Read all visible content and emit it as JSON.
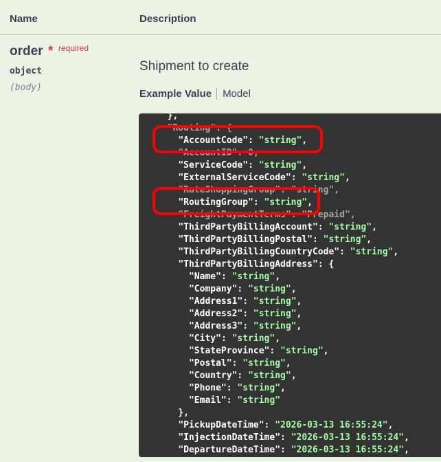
{
  "table": {
    "header_name": "Name",
    "header_description": "Description"
  },
  "parameter": {
    "name": "order",
    "required_star": "*",
    "required_label": "required",
    "type": "object",
    "in": "(body)",
    "description": "Shipment to create"
  },
  "tabs": {
    "example_value": "Example Value",
    "model": "Model"
  },
  "code_lines": [
    {
      "indent": "  ",
      "parts": [
        {
          "c": "p",
          "t": "},"
        }
      ]
    },
    {
      "indent": "  ",
      "parts": [
        {
          "c": "o",
          "t": "\"Routing\": {"
        }
      ]
    },
    {
      "indent": "    ",
      "parts": [
        {
          "c": "k",
          "t": "\"AccountCode\""
        },
        {
          "c": "p",
          "t": ": "
        },
        {
          "c": "s",
          "t": "\"string\""
        },
        {
          "c": "p",
          "t": ","
        }
      ]
    },
    {
      "indent": "    ",
      "parts": [
        {
          "c": "o",
          "t": "\"AccountID\": 0,"
        }
      ]
    },
    {
      "indent": "    ",
      "parts": [
        {
          "c": "k",
          "t": "\"ServiceCode\""
        },
        {
          "c": "p",
          "t": ": "
        },
        {
          "c": "s",
          "t": "\"string\""
        },
        {
          "c": "p",
          "t": ","
        }
      ]
    },
    {
      "indent": "    ",
      "parts": [
        {
          "c": "k",
          "t": "\"ExternalServiceCode\""
        },
        {
          "c": "p",
          "t": ": "
        },
        {
          "c": "s",
          "t": "\"string\""
        },
        {
          "c": "p",
          "t": ","
        }
      ]
    },
    {
      "indent": "    ",
      "parts": [
        {
          "c": "o",
          "t": "\"RateShoppingGroup\": \"string\","
        }
      ]
    },
    {
      "indent": "    ",
      "parts": [
        {
          "c": "k",
          "t": "\"RoutingGroup\""
        },
        {
          "c": "p",
          "t": ": "
        },
        {
          "c": "s",
          "t": "\"string\""
        },
        {
          "c": "p",
          "t": ","
        }
      ]
    },
    {
      "indent": "    ",
      "parts": [
        {
          "c": "o",
          "t": "\"FreightPaymentTerms\": \"Prepaid\","
        }
      ]
    },
    {
      "indent": "    ",
      "parts": [
        {
          "c": "k",
          "t": "\"ThirdPartyBillingAccount\""
        },
        {
          "c": "p",
          "t": ": "
        },
        {
          "c": "s",
          "t": "\"string\""
        },
        {
          "c": "p",
          "t": ","
        }
      ]
    },
    {
      "indent": "    ",
      "parts": [
        {
          "c": "k",
          "t": "\"ThirdPartyBillingPostal\""
        },
        {
          "c": "p",
          "t": ": "
        },
        {
          "c": "s",
          "t": "\"string\""
        },
        {
          "c": "p",
          "t": ","
        }
      ]
    },
    {
      "indent": "    ",
      "parts": [
        {
          "c": "k",
          "t": "\"ThirdPartyBillingCountryCode\""
        },
        {
          "c": "p",
          "t": ": "
        },
        {
          "c": "s",
          "t": "\"string\""
        },
        {
          "c": "p",
          "t": ","
        }
      ]
    },
    {
      "indent": "    ",
      "parts": [
        {
          "c": "k",
          "t": "\"ThirdPartyBillingAddress\""
        },
        {
          "c": "p",
          "t": ": {"
        }
      ]
    },
    {
      "indent": "      ",
      "parts": [
        {
          "c": "k",
          "t": "\"Name\""
        },
        {
          "c": "p",
          "t": ": "
        },
        {
          "c": "s",
          "t": "\"string\""
        },
        {
          "c": "p",
          "t": ","
        }
      ]
    },
    {
      "indent": "      ",
      "parts": [
        {
          "c": "k",
          "t": "\"Company\""
        },
        {
          "c": "p",
          "t": ": "
        },
        {
          "c": "s",
          "t": "\"string\""
        },
        {
          "c": "p",
          "t": ","
        }
      ]
    },
    {
      "indent": "      ",
      "parts": [
        {
          "c": "k",
          "t": "\"Address1\""
        },
        {
          "c": "p",
          "t": ": "
        },
        {
          "c": "s",
          "t": "\"string\""
        },
        {
          "c": "p",
          "t": ","
        }
      ]
    },
    {
      "indent": "      ",
      "parts": [
        {
          "c": "k",
          "t": "\"Address2\""
        },
        {
          "c": "p",
          "t": ": "
        },
        {
          "c": "s",
          "t": "\"string\""
        },
        {
          "c": "p",
          "t": ","
        }
      ]
    },
    {
      "indent": "      ",
      "parts": [
        {
          "c": "k",
          "t": "\"Address3\""
        },
        {
          "c": "p",
          "t": ": "
        },
        {
          "c": "s",
          "t": "\"string\""
        },
        {
          "c": "p",
          "t": ","
        }
      ]
    },
    {
      "indent": "      ",
      "parts": [
        {
          "c": "k",
          "t": "\"City\""
        },
        {
          "c": "p",
          "t": ": "
        },
        {
          "c": "s",
          "t": "\"string\""
        },
        {
          "c": "p",
          "t": ","
        }
      ]
    },
    {
      "indent": "      ",
      "parts": [
        {
          "c": "k",
          "t": "\"StateProvince\""
        },
        {
          "c": "p",
          "t": ": "
        },
        {
          "c": "s",
          "t": "\"string\""
        },
        {
          "c": "p",
          "t": ","
        }
      ]
    },
    {
      "indent": "      ",
      "parts": [
        {
          "c": "k",
          "t": "\"Postal\""
        },
        {
          "c": "p",
          "t": ": "
        },
        {
          "c": "s",
          "t": "\"string\""
        },
        {
          "c": "p",
          "t": ","
        }
      ]
    },
    {
      "indent": "      ",
      "parts": [
        {
          "c": "k",
          "t": "\"Country\""
        },
        {
          "c": "p",
          "t": ": "
        },
        {
          "c": "s",
          "t": "\"string\""
        },
        {
          "c": "p",
          "t": ","
        }
      ]
    },
    {
      "indent": "      ",
      "parts": [
        {
          "c": "k",
          "t": "\"Phone\""
        },
        {
          "c": "p",
          "t": ": "
        },
        {
          "c": "s",
          "t": "\"string\""
        },
        {
          "c": "p",
          "t": ","
        }
      ]
    },
    {
      "indent": "      ",
      "parts": [
        {
          "c": "k",
          "t": "\"Email\""
        },
        {
          "c": "p",
          "t": ": "
        },
        {
          "c": "s",
          "t": "\"string\""
        }
      ]
    },
    {
      "indent": "    ",
      "parts": [
        {
          "c": "p",
          "t": "},"
        }
      ]
    },
    {
      "indent": "    ",
      "parts": [
        {
          "c": "k",
          "t": "\"PickupDateTime\""
        },
        {
          "c": "p",
          "t": ": "
        },
        {
          "c": "s",
          "t": "\"2026-03-13 16:55:24\""
        },
        {
          "c": "p",
          "t": ","
        }
      ]
    },
    {
      "indent": "    ",
      "parts": [
        {
          "c": "k",
          "t": "\"InjectionDateTime\""
        },
        {
          "c": "p",
          "t": ": "
        },
        {
          "c": "s",
          "t": "\"2026-03-13 16:55:24\""
        },
        {
          "c": "p",
          "t": ","
        }
      ]
    },
    {
      "indent": "    ",
      "parts": [
        {
          "c": "k",
          "t": "\"DepartureDateTime\""
        },
        {
          "c": "p",
          "t": ": "
        },
        {
          "c": "s",
          "t": "\"2026-03-13 16:55:24\""
        },
        {
          "c": "p",
          "t": ","
        }
      ]
    }
  ],
  "colors": {
    "background": "#ebf3e5",
    "code_background": "#333333",
    "string_value": "#a2fca2",
    "required": "#e63535",
    "annotation": "#ff0000"
  }
}
